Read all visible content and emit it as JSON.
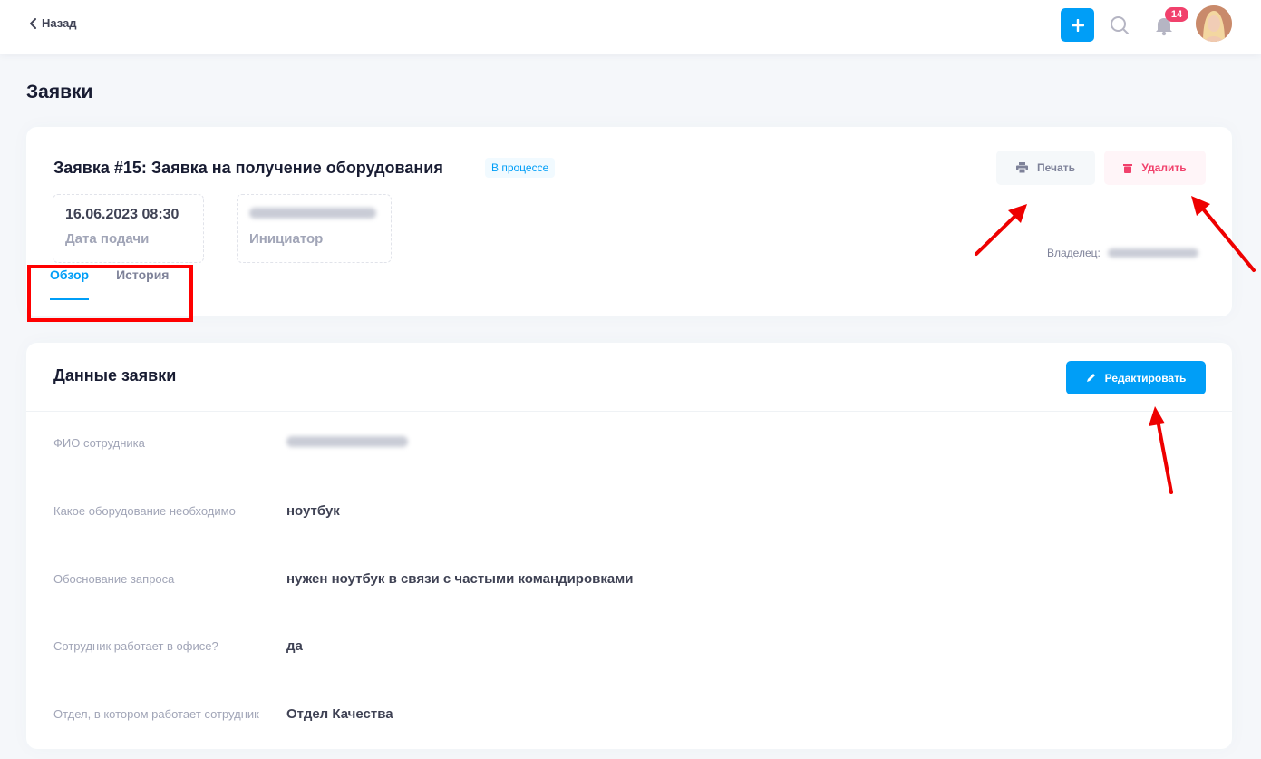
{
  "topbar": {
    "back_label": "Назад",
    "notifications_count": "14"
  },
  "page": {
    "title": "Заявки"
  },
  "request": {
    "title": "Заявка #15: Заявка на получение оборудования",
    "status": "В процессе",
    "print_label": "Печать",
    "delete_label": "Удалить",
    "date_value": "16.06.2023 08:30",
    "date_label": "Дата подачи",
    "initiator_label": "Инициатор",
    "owner_label": "Владелец:",
    "tabs": [
      {
        "label": "Обзор",
        "active": true
      },
      {
        "label": "История",
        "active": false
      }
    ]
  },
  "details": {
    "title": "Данные заявки",
    "edit_label": "Редактировать",
    "rows": [
      {
        "label": "ФИО сотрудника",
        "value": ""
      },
      {
        "label": "Какое оборудование необходимо",
        "value": "ноутбук"
      },
      {
        "label": "Обоснование запроса",
        "value": "нужен ноутбук в связи с частыми командировками"
      },
      {
        "label": "Сотрудник работает в офисе?",
        "value": "да"
      },
      {
        "label": "Отдел, в котором работает сотрудник",
        "value": "Отдел Качества"
      }
    ]
  },
  "colors": {
    "accent": "#009ef7",
    "danger": "#f1416c",
    "annotation": "#ff0000"
  }
}
